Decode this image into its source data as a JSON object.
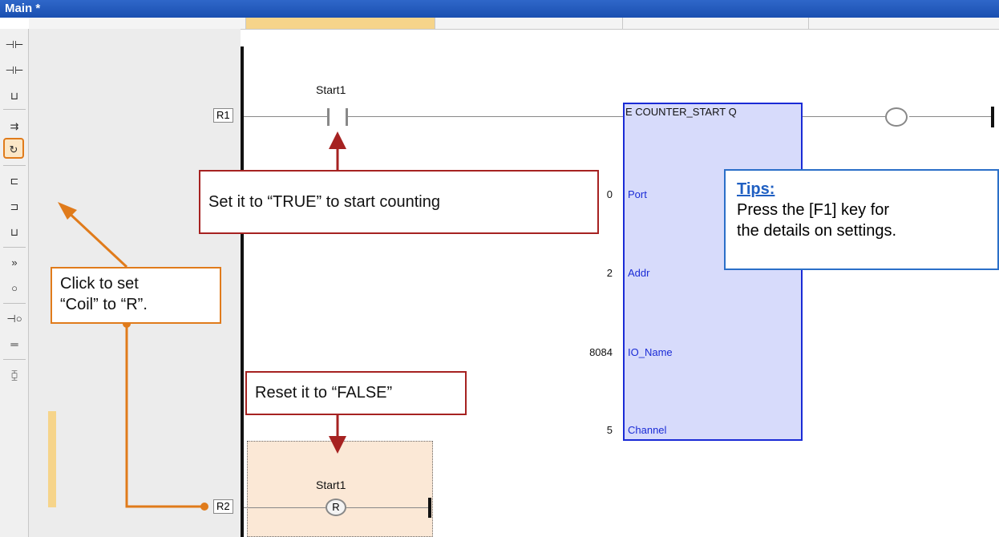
{
  "window": {
    "title": "Main *"
  },
  "rungs": [
    {
      "label": "R1"
    },
    {
      "label": "R2"
    }
  ],
  "contact": {
    "variable": "Start1"
  },
  "reset_coil": {
    "variable": "Start1",
    "symbol": "R"
  },
  "function_block": {
    "title": "E COUNTER_START Q",
    "inputs": [
      {
        "value": "0",
        "pin": "Port"
      },
      {
        "value": "2",
        "pin": "Addr"
      },
      {
        "value": "8084",
        "pin": "IO_Name"
      },
      {
        "value": "5",
        "pin": "Channel"
      }
    ]
  },
  "callouts": {
    "start": "Set it to “TRUE” to start counting",
    "reset": "Reset it to “FALSE”",
    "coil_line1": "Click to set",
    "coil_line2": "“Coil” to “R”."
  },
  "tips": {
    "title": "Tips:",
    "line1": "Press the [F1] key for",
    "line2": "the details on settings."
  },
  "toolbar": {
    "tools": [
      "contact-before-icon",
      "contact-after-icon",
      "parallel-contact-icon",
      "horizontal-line-icon",
      "coil-type-toggle-icon",
      "block-before-icon",
      "block-after-icon",
      "parallel-block-icon",
      "jump-icon",
      "coil-icon",
      "contact-coil-icon",
      "double-line-icon",
      "comment-icon"
    ]
  },
  "colors": {
    "accent_red": "#a62221",
    "accent_orange": "#e07b1b",
    "block_fill": "#d7dbfb",
    "block_border": "#1a2bd6",
    "tips_border": "#2b6fc8"
  }
}
